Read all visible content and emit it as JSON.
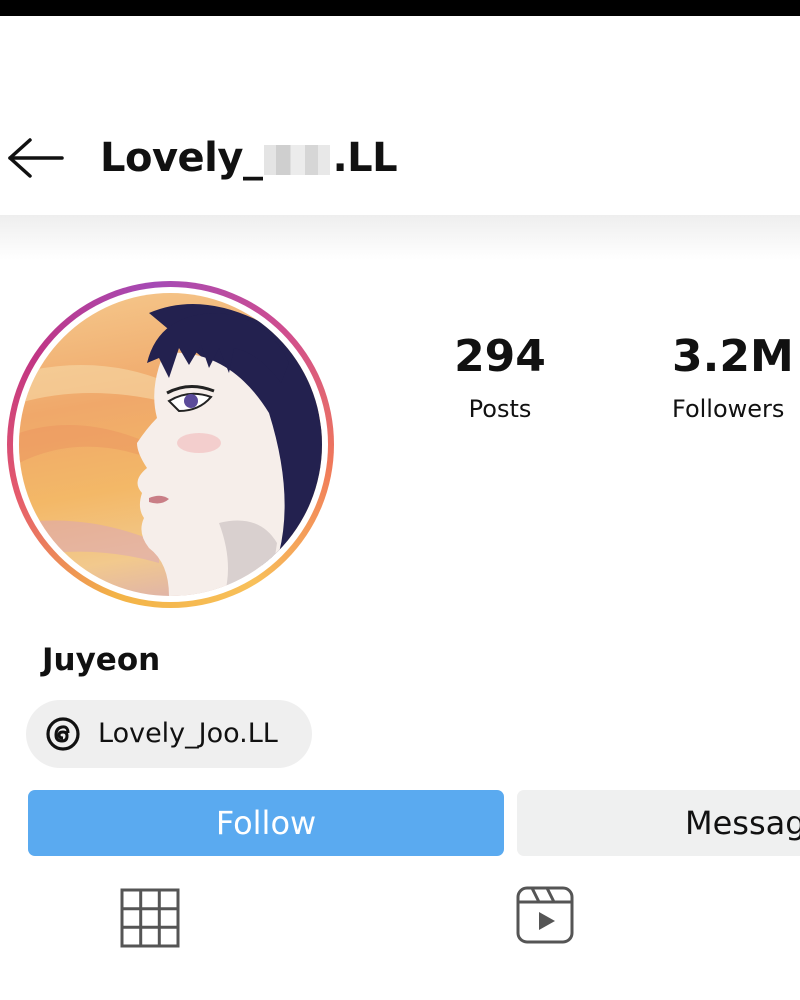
{
  "header": {
    "username_prefix": "Lovely_",
    "username_suffix": ".LL",
    "back_icon": "arrow-left-icon"
  },
  "profile": {
    "display_name": "Juyeon",
    "threads_handle": "Lovely_Joo.LL",
    "threads_icon": "threads-icon",
    "avatar_ring_colors": [
      "#f3b347",
      "#e55b6c",
      "#c13584",
      "#a54ab5"
    ]
  },
  "stats": {
    "posts_count": "294",
    "posts_label": "Posts",
    "followers_count": "3.2M",
    "followers_label": "Followers"
  },
  "actions": {
    "follow_label": "Follow",
    "message_label": "Messag",
    "follow_color": "#5aaaf0"
  },
  "tabs": [
    {
      "icon": "grid-icon"
    },
    {
      "icon": "reels-icon"
    }
  ]
}
